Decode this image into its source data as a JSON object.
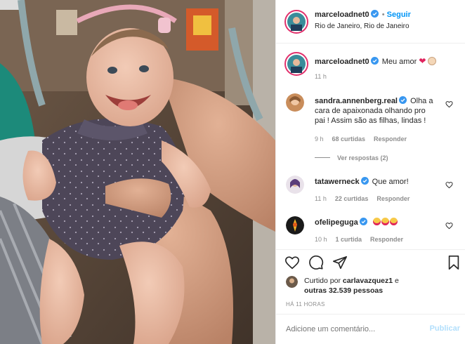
{
  "post": {
    "author": "marceloadnet0",
    "follow_label": "Seguir",
    "separator": "•",
    "location": "Rio de Janeiro, Rio de Janeiro"
  },
  "caption": {
    "author": "marceloadnet0",
    "text": "Meu amor",
    "time": "11 h"
  },
  "comments": [
    {
      "user": "sandra.annenberg.real",
      "text": "Olha a cara de apaixonada olhando pro pai ! Assim são as filhas, lindas !",
      "lines": [
        "Olha a",
        "cara de apaixonada olhando pro",
        "pai ! Assim são as filhas, lindas !"
      ],
      "time": "9 h",
      "likes": "68 curtidas",
      "reply": "Responder",
      "view_replies": "Ver respostas (2)"
    },
    {
      "user": "tatawerneck",
      "text": "Que amor!",
      "time": "11 h",
      "likes": "22 curtidas",
      "reply": "Responder"
    },
    {
      "user": "ofelipeguga",
      "text": "",
      "time": "10 h",
      "likes": "1 curtida",
      "reply": "Responder"
    }
  ],
  "likes": {
    "prefix": "Curtido por",
    "user": "carlavazquez1",
    "conj": "e",
    "others": "outras 32.539 pessoas"
  },
  "timestamp": "HÁ 11 HORAS",
  "add_comment": {
    "placeholder": "Adicione um comentário...",
    "publish_label": "Publicar"
  },
  "icons": {
    "verified": "verified-badge-icon",
    "heart": "heart-icon",
    "comment": "comment-icon",
    "share": "share-icon",
    "save": "save-icon",
    "emoji": "emoji-icon"
  },
  "colors": {
    "accent": "#0095f6",
    "text": "#262626",
    "muted": "#8e8e8e",
    "heart_red": "#e0245e",
    "emoji_yellow": "#f7c948"
  }
}
